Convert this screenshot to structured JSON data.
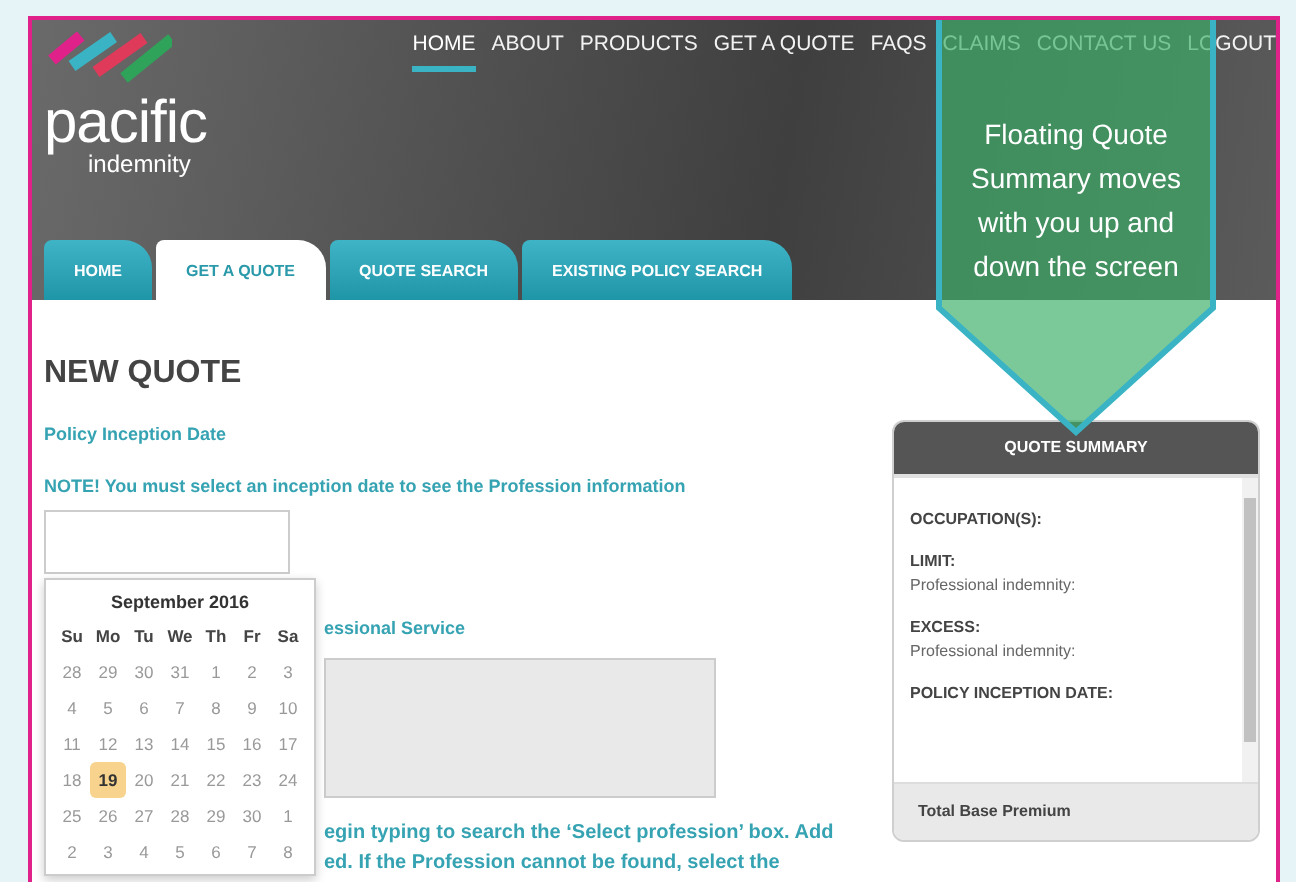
{
  "header": {
    "logo": {
      "name": "pacific",
      "tagline": "indemnity"
    },
    "nav": [
      {
        "label": "HOME",
        "selected": true
      },
      {
        "label": "ABOUT",
        "selected": false
      },
      {
        "label": "PRODUCTS",
        "selected": false
      },
      {
        "label": "GET A QUOTE",
        "selected": false
      },
      {
        "label": "FAQS",
        "selected": false
      },
      {
        "label": "CLAIMS",
        "selected": false
      },
      {
        "label": "CONTACT US",
        "selected": false
      },
      {
        "label": "LOGOUT",
        "selected": false
      }
    ]
  },
  "tabs": [
    {
      "label": "HOME",
      "selected": false
    },
    {
      "label": "GET A QUOTE",
      "selected": true
    },
    {
      "label": "QUOTE SEARCH",
      "selected": false
    },
    {
      "label": "EXISTING POLICY SEARCH",
      "selected": false
    }
  ],
  "callout": {
    "text": "Floating Quote Summary moves with you up and down the screen"
  },
  "form": {
    "title": "NEW QUOTE",
    "inception_label": "Policy Inception Date",
    "note": "NOTE! You must select an inception date to see the Profession information",
    "service_label": "essional Service",
    "help_lines": [
      "egin typing to search the ‘Select profession’ box. Add",
      "ed. If the Profession cannot be found, select the"
    ]
  },
  "calendar": {
    "month": "September 2016",
    "weekdays": [
      "Su",
      "Mo",
      "Tu",
      "We",
      "Th",
      "Fr",
      "Sa"
    ],
    "weeks": [
      [
        {
          "day": "28",
          "selected": false
        },
        {
          "day": "29",
          "selected": false
        },
        {
          "day": "30",
          "selected": false
        },
        {
          "day": "31",
          "selected": false
        },
        {
          "day": "1",
          "selected": false
        },
        {
          "day": "2",
          "selected": false
        },
        {
          "day": "3",
          "selected": false
        }
      ],
      [
        {
          "day": "4",
          "selected": false
        },
        {
          "day": "5",
          "selected": false
        },
        {
          "day": "6",
          "selected": false
        },
        {
          "day": "7",
          "selected": false
        },
        {
          "day": "8",
          "selected": false
        },
        {
          "day": "9",
          "selected": false
        },
        {
          "day": "10",
          "selected": false
        }
      ],
      [
        {
          "day": "11",
          "selected": false
        },
        {
          "day": "12",
          "selected": false
        },
        {
          "day": "13",
          "selected": false
        },
        {
          "day": "14",
          "selected": false
        },
        {
          "day": "15",
          "selected": false
        },
        {
          "day": "16",
          "selected": false
        },
        {
          "day": "17",
          "selected": false
        }
      ],
      [
        {
          "day": "18",
          "selected": false
        },
        {
          "day": "19",
          "selected": true
        },
        {
          "day": "20",
          "selected": false
        },
        {
          "day": "21",
          "selected": false
        },
        {
          "day": "22",
          "selected": false
        },
        {
          "day": "23",
          "selected": false
        },
        {
          "day": "24",
          "selected": false
        }
      ],
      [
        {
          "day": "25",
          "selected": false
        },
        {
          "day": "26",
          "selected": false
        },
        {
          "day": "27",
          "selected": false
        },
        {
          "day": "28",
          "selected": false
        },
        {
          "day": "29",
          "selected": false
        },
        {
          "day": "30",
          "selected": false
        },
        {
          "day": "1",
          "selected": false
        }
      ],
      [
        {
          "day": "2",
          "selected": false
        },
        {
          "day": "3",
          "selected": false
        },
        {
          "day": "4",
          "selected": false
        },
        {
          "day": "5",
          "selected": false
        },
        {
          "day": "6",
          "selected": false
        },
        {
          "day": "7",
          "selected": false
        },
        {
          "day": "8",
          "selected": false
        }
      ]
    ]
  },
  "summary": {
    "title": "QUOTE SUMMARY",
    "sections": [
      {
        "heading": "OCCUPATION(S):"
      },
      {
        "heading": "LIMIT:",
        "lines": [
          "Professional indemnity:"
        ]
      },
      {
        "heading": "EXCESS:",
        "lines": [
          "Professional indemnity:"
        ]
      },
      {
        "heading": "POLICY INCEPTION DATE:"
      }
    ],
    "footer": "Total Base Premium"
  }
}
